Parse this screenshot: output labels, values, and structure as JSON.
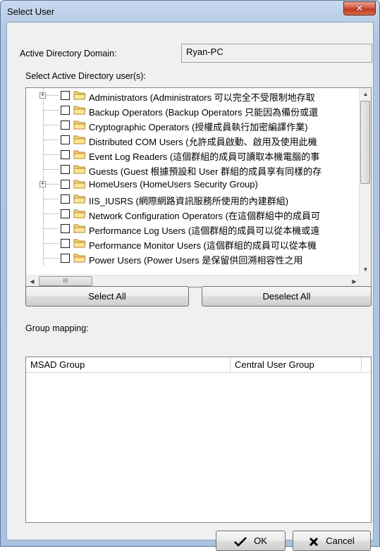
{
  "window": {
    "title": "Select User"
  },
  "domain": {
    "label": "Active Directory Domain:",
    "value": "Ryan-PC"
  },
  "users_section": {
    "label": "Select Active Directory user(s):"
  },
  "tree_items": [
    {
      "label": "Administrators (Administrators 可以完全不受限制地存取",
      "expandable": true
    },
    {
      "label": "Backup Operators (Backup Operators 只能因為備份或還",
      "expandable": false
    },
    {
      "label": "Cryptographic Operators (授權成員執行加密編譯作業)",
      "expandable": false
    },
    {
      "label": "Distributed COM Users (允許成員啟動、啟用及使用此機",
      "expandable": false
    },
    {
      "label": "Event Log Readers (這個群組的成員可讀取本機電腦的事",
      "expandable": false
    },
    {
      "label": "Guests (Guest 根據預設和 User 群組的成員享有同樣的存",
      "expandable": false
    },
    {
      "label": "HomeUsers (HomeUsers Security Group)",
      "expandable": true
    },
    {
      "label": "IIS_IUSRS (網際網路資訊服務所使用的內建群組)",
      "expandable": false
    },
    {
      "label": "Network Configuration Operators (在這個群組中的成員可",
      "expandable": false
    },
    {
      "label": "Performance Log Users (這個群組的成員可以從本機或遠",
      "expandable": false
    },
    {
      "label": "Performance Monitor Users (這個群組的成員可以從本機",
      "expandable": false
    },
    {
      "label": "Power Users (Power Users 是保留供回溯相容性之用",
      "expandable": false
    }
  ],
  "scrollbar": {
    "h_thumb_glyph": "III"
  },
  "buttons": {
    "select_all": "Select All",
    "deselect_all": "Deselect All",
    "ok": "OK",
    "cancel": "Cancel"
  },
  "mapping": {
    "label": "Group mapping:",
    "columns": [
      "MSAD Group",
      "Central User Group"
    ]
  },
  "colors": {
    "titlebar": "#b8cde6",
    "close": "#c0391f",
    "client": "#f0f0f0"
  }
}
